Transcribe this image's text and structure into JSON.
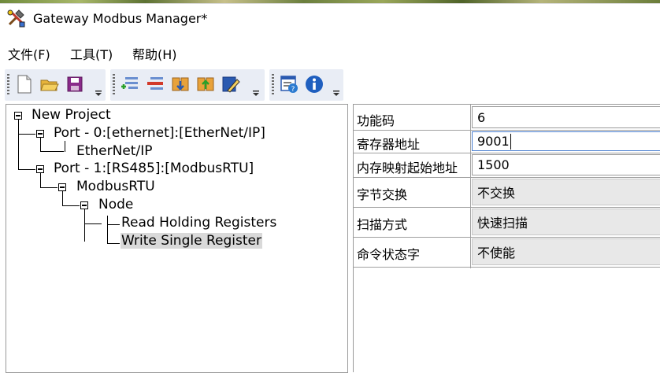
{
  "window": {
    "title": "Gateway Modbus Manager*"
  },
  "menu": [
    {
      "label": "文件(F)"
    },
    {
      "label": "工具(T)"
    },
    {
      "label": "帮助(H)"
    }
  ],
  "toolbar": {
    "group1": [
      "new-file-icon",
      "open-folder-icon",
      "save-icon"
    ],
    "group2": [
      "add-port-icon",
      "delete-port-icon",
      "add-node-icon",
      "add-command-icon",
      "edit-icon"
    ],
    "group3": [
      "properties-help-icon",
      "info-icon"
    ]
  },
  "tree": {
    "root": "New Project",
    "port0": "Port - 0:[ethernet]:[EtherNet/IP]",
    "port0_child": "EtherNet/IP",
    "port1": "Port - 1:[RS485]:[ModbusRTU]",
    "modbus": "ModbusRTU",
    "node": "Node",
    "cmd1": "Read Holding Registers",
    "cmd2": "Write Single Register"
  },
  "properties": [
    {
      "name": "功能码",
      "value": "6",
      "type": "text"
    },
    {
      "name": "寄存器地址",
      "value": "9001",
      "type": "text-active"
    },
    {
      "name": "内存映射起始地址",
      "value": "1500",
      "type": "text"
    },
    {
      "name": "字节交换",
      "value": "不交换",
      "type": "combo"
    },
    {
      "name": "扫描方式",
      "value": "快速扫描",
      "type": "combo"
    },
    {
      "name": "命令状态字",
      "value": "不使能",
      "type": "combo"
    }
  ],
  "colors": {
    "accent": "#4a7fd0",
    "toolbar_bg": "#e9edf5",
    "selection": "#d9d9d9"
  }
}
